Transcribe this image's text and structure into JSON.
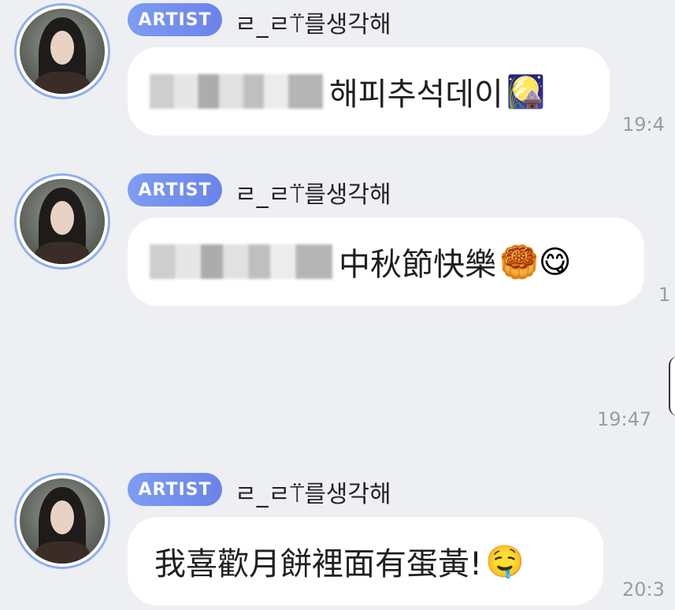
{
  "messages": [
    {
      "badge": "ARTIST",
      "nickname": "ㄹ_ㄹ⍡를생각해",
      "text": "해피추석데이",
      "emoji": "🎑",
      "time": "19:4"
    },
    {
      "badge": "ARTIST",
      "nickname": "ㄹ_ㄹ⍡를생각해",
      "text": "中秋節快樂",
      "emoji": "🥮😋",
      "time": "1"
    },
    {
      "time": "19:47"
    },
    {
      "badge": "ARTIST",
      "nickname": "ㄹ_ㄹ⍡를생각해",
      "text": "我喜歡月餅裡面有蛋黃!",
      "emoji": "🤤",
      "time": "20:3"
    }
  ]
}
